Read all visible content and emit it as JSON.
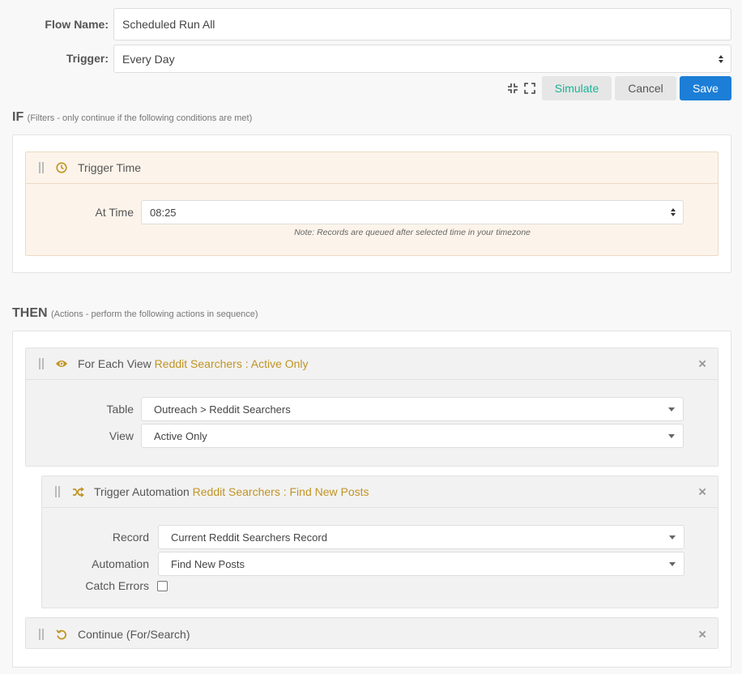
{
  "header": {
    "flow_name_label": "Flow Name:",
    "flow_name_value": "Scheduled Run All",
    "trigger_label": "Trigger:",
    "trigger_value": "Every Day"
  },
  "toolbar": {
    "simulate_label": "Simulate",
    "cancel_label": "Cancel",
    "save_label": "Save"
  },
  "if_section": {
    "title": "IF",
    "subtitle": "(Filters - only continue if the following conditions are met)",
    "card": {
      "title": "Trigger Time",
      "icon": "clock-icon",
      "at_time_label": "At Time",
      "at_time_value": "08:25",
      "note": "Note: Records are queued after selected time in your timezone"
    }
  },
  "then_section": {
    "title": "THEN",
    "subtitle": "(Actions - perform the following actions in sequence)",
    "for_each": {
      "prefix": "For Each View",
      "highlight": "Reddit Searchers : Active Only",
      "icon": "eye-icon",
      "close": "×",
      "table_label": "Table",
      "table_value": "Outreach > Reddit Searchers",
      "view_label": "View",
      "view_value": "Active Only"
    },
    "trigger_automation": {
      "prefix": "Trigger Automation",
      "highlight": "Reddit Searchers : Find New Posts",
      "icon": "shuffle-icon",
      "close": "×",
      "record_label": "Record",
      "record_value": "Current Reddit Searchers Record",
      "automation_label": "Automation",
      "automation_value": "Find New Posts",
      "catch_errors_label": "Catch Errors"
    },
    "continue": {
      "title": "Continue (For/Search)",
      "icon": "undo-icon",
      "close": "×"
    }
  },
  "colors": {
    "accent": "#c19424",
    "primary": "#1c7ed6",
    "simulate_text": "#1ab394",
    "peach_bg": "#fcf4ea"
  }
}
